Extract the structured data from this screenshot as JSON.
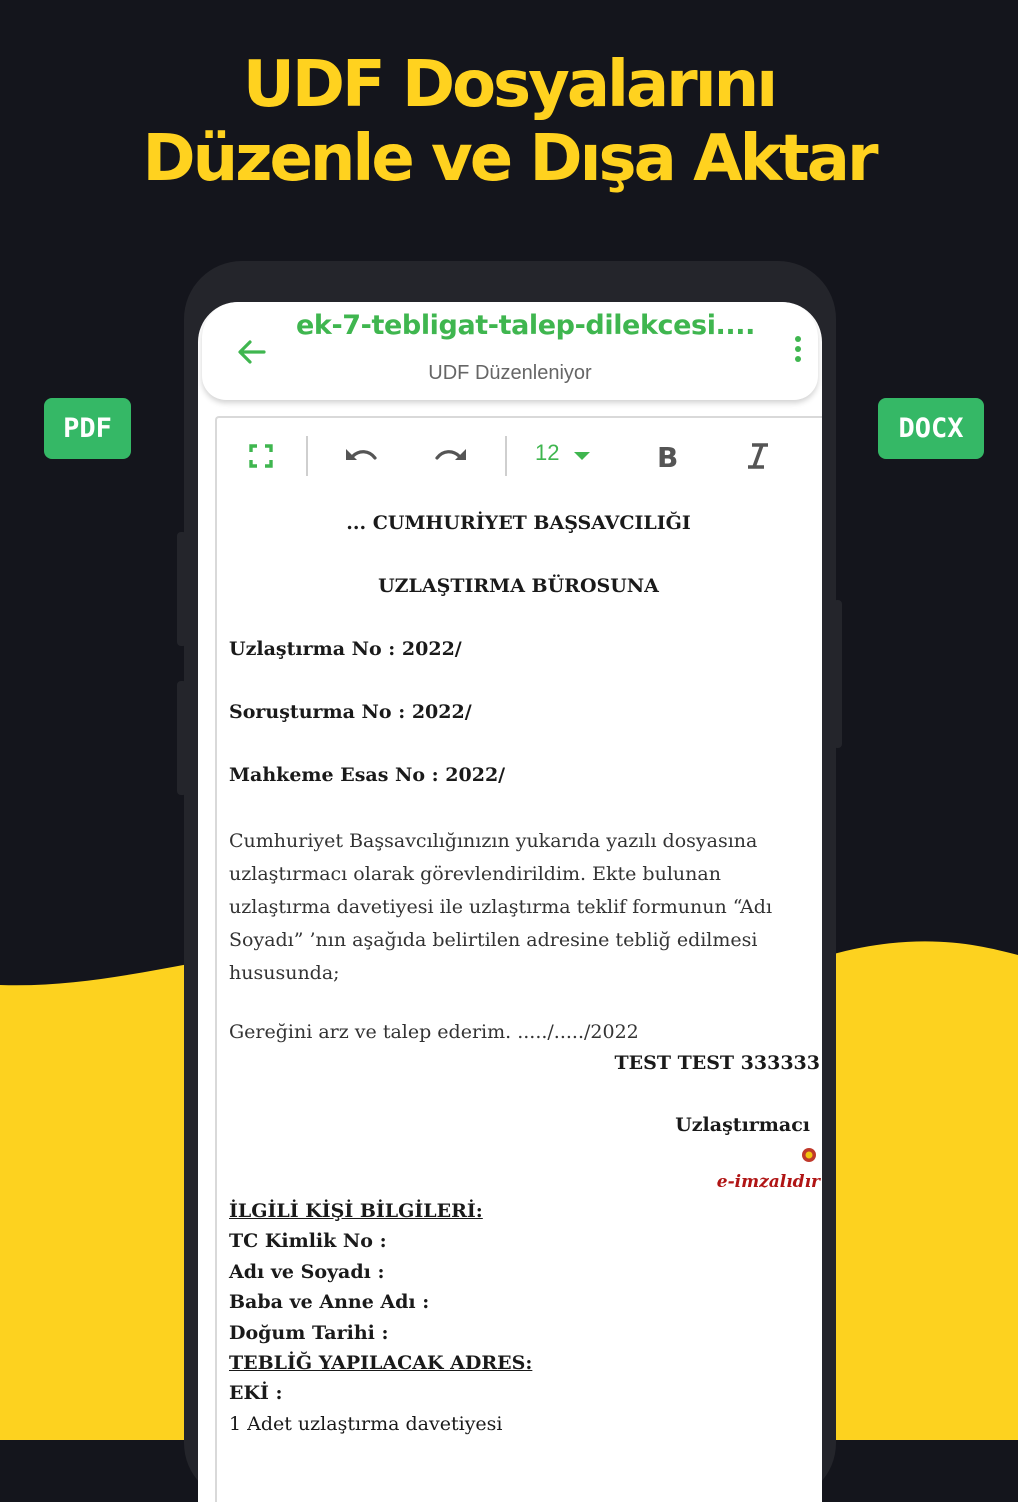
{
  "headline": {
    "line1": "UDF Dosyalarını",
    "line2": "Düzenle ve Dışa Aktar"
  },
  "badges": {
    "pdf": "PDF",
    "docx": "DOCX"
  },
  "colors": {
    "background": "#14151c",
    "accent_yellow": "#ffd21f",
    "badge_green": "#35b866",
    "app_green": "#3fb64f"
  },
  "appbar": {
    "title": "ek-7-tebligat-talep-dilekcesi....",
    "subtitle": "UDF Düzenleniyor",
    "back_icon": "arrow-left-icon",
    "more_icon": "more-vert-icon"
  },
  "toolbar": {
    "fullscreen_icon": "fullscreen-icon",
    "undo_icon": "undo-icon",
    "redo_icon": "redo-icon",
    "font_size": "12",
    "bold_icon": "bold-icon",
    "italic_icon": "italic-icon"
  },
  "document": {
    "heading1": "... CUMHURİYET BAŞSAVCILIĞI",
    "heading2": "UZLAŞTIRMA BÜROSUNA",
    "uzlastirma_no": "Uzlaştırma No  : 2022/",
    "sorusturma_no": "Soruşturma No : 2022/",
    "mahkeme_no": "Mahkeme Esas No  : 2022/",
    "paragraph": "Cumhuriyet Başsavcılığınızın yukarıda yazılı dosyasına uzlaştırmacı olarak görevlendirildim. Ekte bulunan uzlaştırma davetiyesi ile uzlaştırma teklif formunun “Adı Soyadı” ’nın aşağıda belirtilen adresine tebliğ edilmesi hususunda;",
    "request": "Gereğini arz ve talep ederim. ...../...../2022",
    "signer": "TEST TEST 333333",
    "role": "Uzlaştırmacı",
    "esign": "e-imzalıdır",
    "section_title": "İLGİLİ KİŞİ BİLGİLERİ:",
    "tc": "TC Kimlik No  :",
    "name": "Adı ve Soyadı    :",
    "parents": "Baba ve Anne Adı :",
    "birth": "Doğum Tarihi :",
    "address_title": "TEBLİĞ YAPILACAK ADRES:",
    "attachments": "EKİ :",
    "attachment1": "1 Adet uzlaştırma davetiyesi"
  }
}
